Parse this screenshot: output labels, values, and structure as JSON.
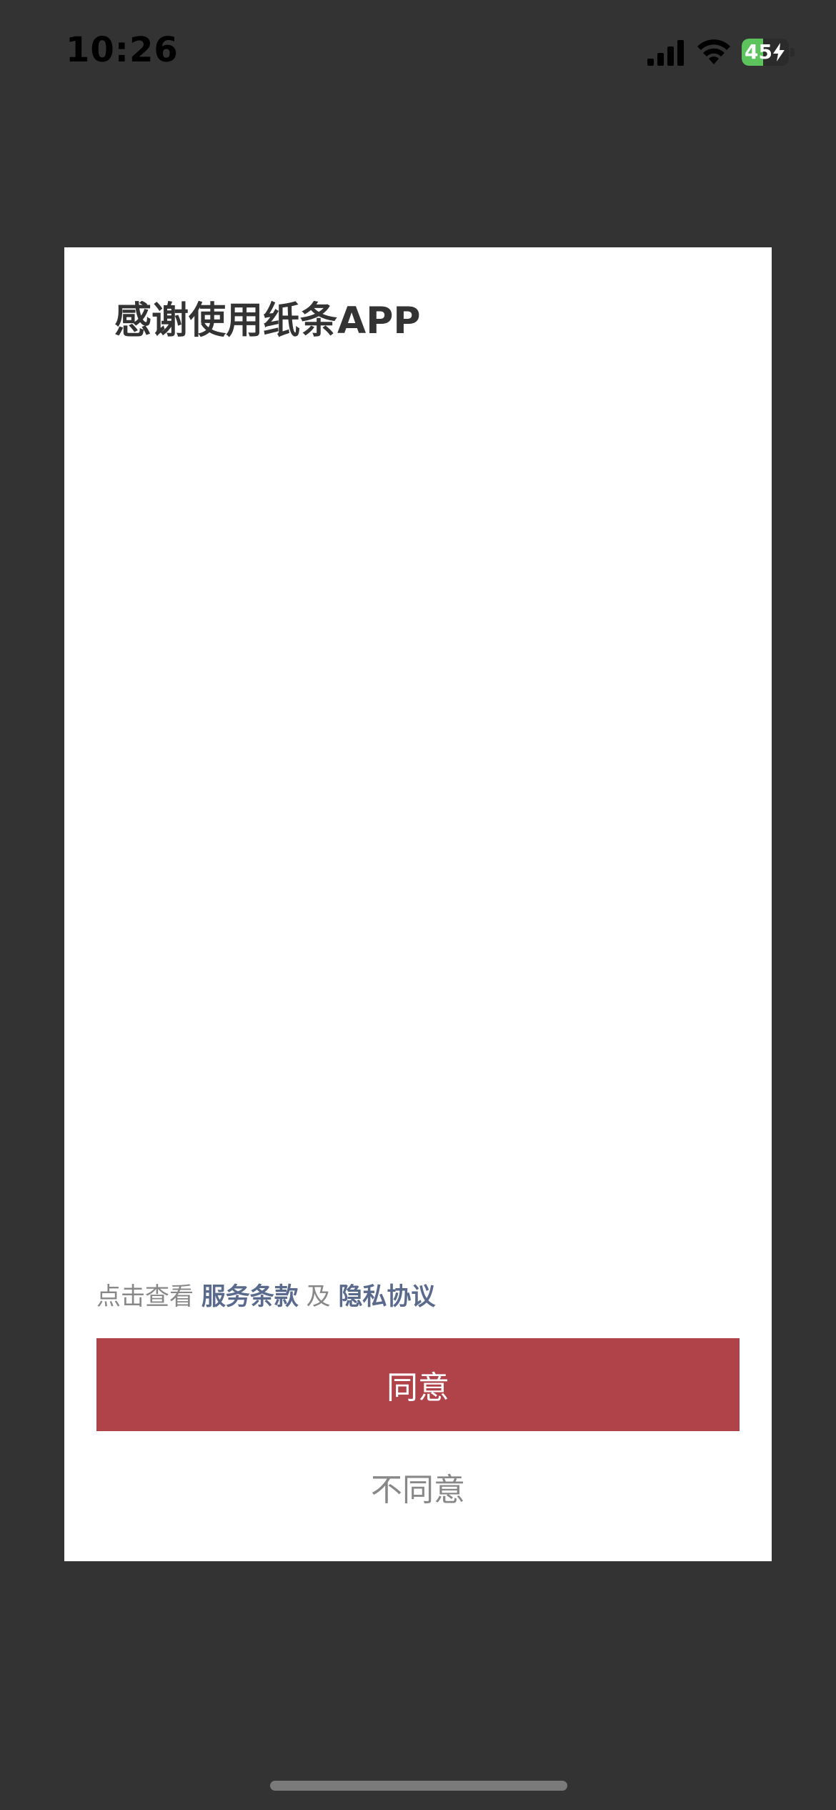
{
  "status_bar": {
    "time": "10:26",
    "battery_level": "45",
    "battery_fraction": 0.45,
    "signal_icon": "cellular-signal-icon",
    "wifi_icon": "wifi-icon",
    "charging_icon": "bolt-icon"
  },
  "dialog": {
    "title": "感谢使用纸条APP",
    "terms": {
      "prefix": "点击查看",
      "service_terms": "服务条款",
      "conjunction": "及",
      "privacy_policy": "隐私协议"
    },
    "agree_label": "同意",
    "disagree_label": "不同意"
  },
  "colors": {
    "background": "#333333",
    "dialog_background": "#ffffff",
    "accent": "#b04249",
    "link": "#5a6a8c",
    "muted_text": "#888888",
    "battery_green": "#5cc35d"
  }
}
